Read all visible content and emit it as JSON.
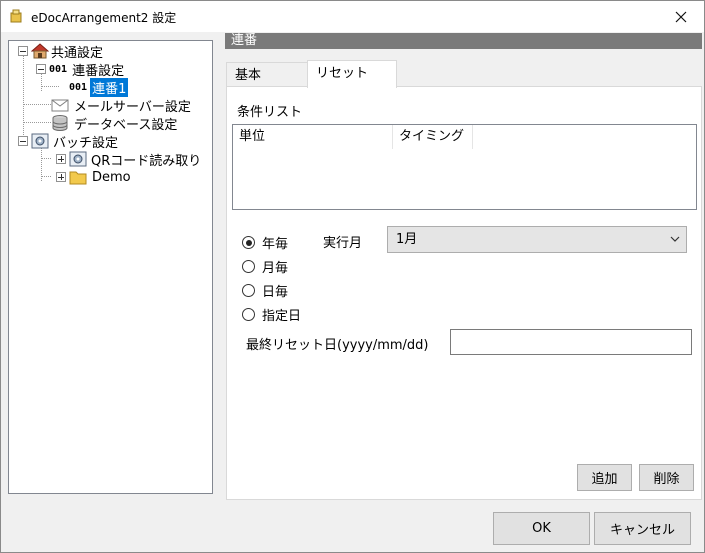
{
  "window": {
    "title": "eDocArrangement2 設定"
  },
  "tree": {
    "items": [
      {
        "label": "共通設定"
      },
      {
        "label": "連番設定",
        "badge": "001"
      },
      {
        "label": "連番1",
        "badge": "001"
      },
      {
        "label": "メールサーバー設定"
      },
      {
        "label": "データベース設定"
      },
      {
        "label": "バッチ設定"
      },
      {
        "label": "QRコード読み取り"
      },
      {
        "label": "Demo"
      }
    ]
  },
  "section": {
    "header": "連番"
  },
  "tabs": [
    {
      "label": "基本"
    },
    {
      "label": "リセット"
    }
  ],
  "condition_list": {
    "label": "条件リスト",
    "columns": [
      "単位",
      "タイミング"
    ]
  },
  "reset": {
    "options": [
      {
        "label": "年毎",
        "checked": true
      },
      {
        "label": "月毎",
        "checked": false
      },
      {
        "label": "日毎",
        "checked": false
      },
      {
        "label": "指定日",
        "checked": false
      }
    ],
    "month_label": "実行月",
    "month_value": "1月",
    "last_reset_label": "最終リセット日(yyyy/mm/dd)",
    "last_reset_value": ""
  },
  "buttons": {
    "add": "追加",
    "delete": "削除",
    "ok": "OK",
    "cancel": "キャンセル"
  }
}
